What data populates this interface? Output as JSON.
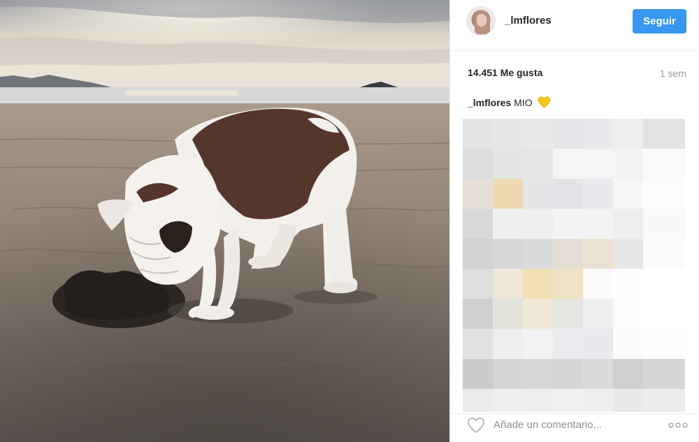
{
  "post": {
    "photo_alt": "",
    "author": {
      "username": "_lmflores"
    },
    "follow_label": "Seguir",
    "likes_text": "14.451 Me gusta",
    "time_text": "1 sem",
    "caption": {
      "author": "_lmflores",
      "text": "MIO",
      "emoji_icon": "yellow-heart-icon"
    },
    "comment_placeholder": "Añade un comentario...",
    "icons": {
      "like": "heart-outline-icon",
      "more": "more-options-icon"
    },
    "colors": {
      "follow_button": "#3897f0",
      "border": "#efefef",
      "muted_text": "#999999",
      "heart_emoji": "#f5c518"
    }
  }
}
